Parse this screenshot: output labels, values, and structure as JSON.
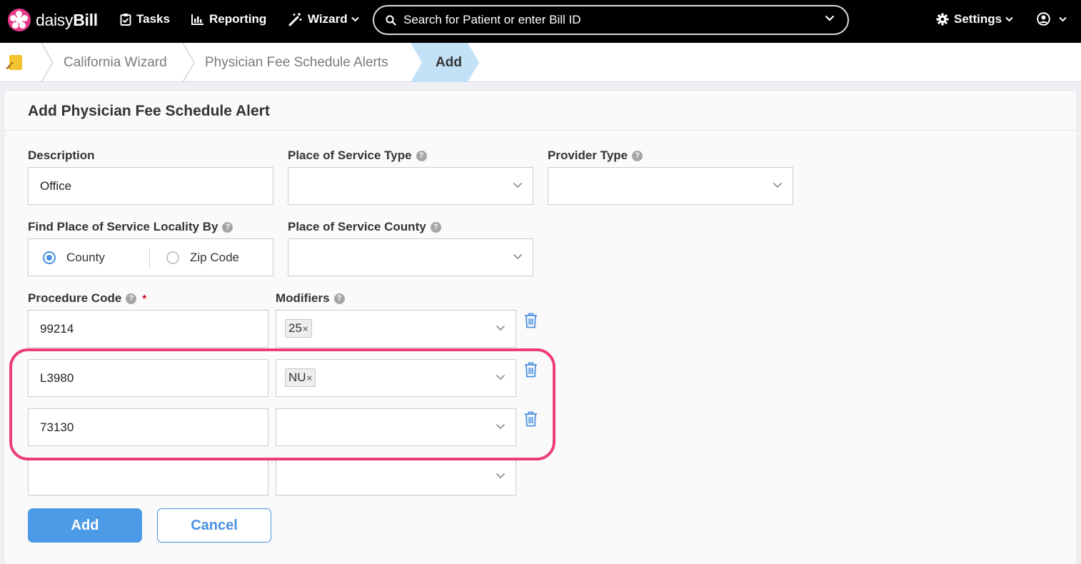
{
  "app": {
    "brand_light": "daisy",
    "brand_bold": "Bill"
  },
  "nav": {
    "tasks": "Tasks",
    "reporting": "Reporting",
    "wizard": "Wizard",
    "settings": "Settings",
    "search_placeholder": "Search for Patient or enter Bill ID"
  },
  "breadcrumb": [
    "California Wizard",
    "Physician Fee Schedule Alerts",
    "Add"
  ],
  "form": {
    "title": "Add Physician Fee Schedule Alert",
    "description_label": "Description",
    "description_value": "Office",
    "pos_type_label": "Place of Service Type",
    "provider_type_label": "Provider Type",
    "locality_label": "Find Place of Service Locality By",
    "locality_options": [
      "County",
      "Zip Code"
    ],
    "locality_selected": "County",
    "county_label": "Place of Service County",
    "procedure_label": "Procedure Code",
    "required_mark": "*",
    "modifiers_label": "Modifiers",
    "rows": [
      {
        "code": "99214",
        "modifier": "25"
      },
      {
        "code": "L3980",
        "modifier": "NU"
      },
      {
        "code": "73130",
        "modifier": ""
      },
      {
        "code": "",
        "modifier": ""
      }
    ],
    "tag_remove": "×",
    "help_glyph": "?",
    "add_label": "Add",
    "cancel_label": "Cancel"
  },
  "colors": {
    "accent": "#4a90e2",
    "primary_button": "#4d9be6",
    "highlight": "#ec3c7c",
    "brand": "#e73a8c",
    "nav_bg": "#000000",
    "crumb_active": "#c3e1f7"
  }
}
